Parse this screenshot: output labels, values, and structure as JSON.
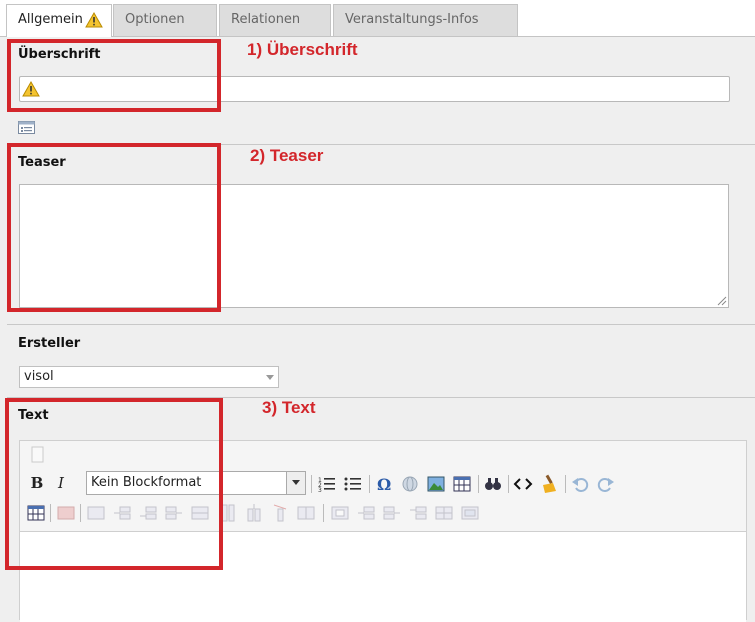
{
  "tabs": [
    {
      "label": "Allgemein",
      "active": true,
      "warning": true
    },
    {
      "label": "Optionen",
      "active": false
    },
    {
      "label": "Relationen",
      "active": false
    },
    {
      "label": "Veranstaltungs-Infos",
      "active": false
    }
  ],
  "fields": {
    "heading_label": "Überschrift",
    "heading_value": "",
    "teaser_label": "Teaser",
    "teaser_value": "",
    "creator_label": "Ersteller",
    "creator_value": "visol",
    "text_label": "Text"
  },
  "editor": {
    "blockformat": "Kein Blockformat",
    "bold": "B",
    "italic": "I"
  },
  "annotations": {
    "a1": "1) Überschrift",
    "a2": "2) Teaser",
    "a3": "3) Text"
  },
  "colors": {
    "annotation": "#d3262b",
    "warning": "#f4c430"
  }
}
